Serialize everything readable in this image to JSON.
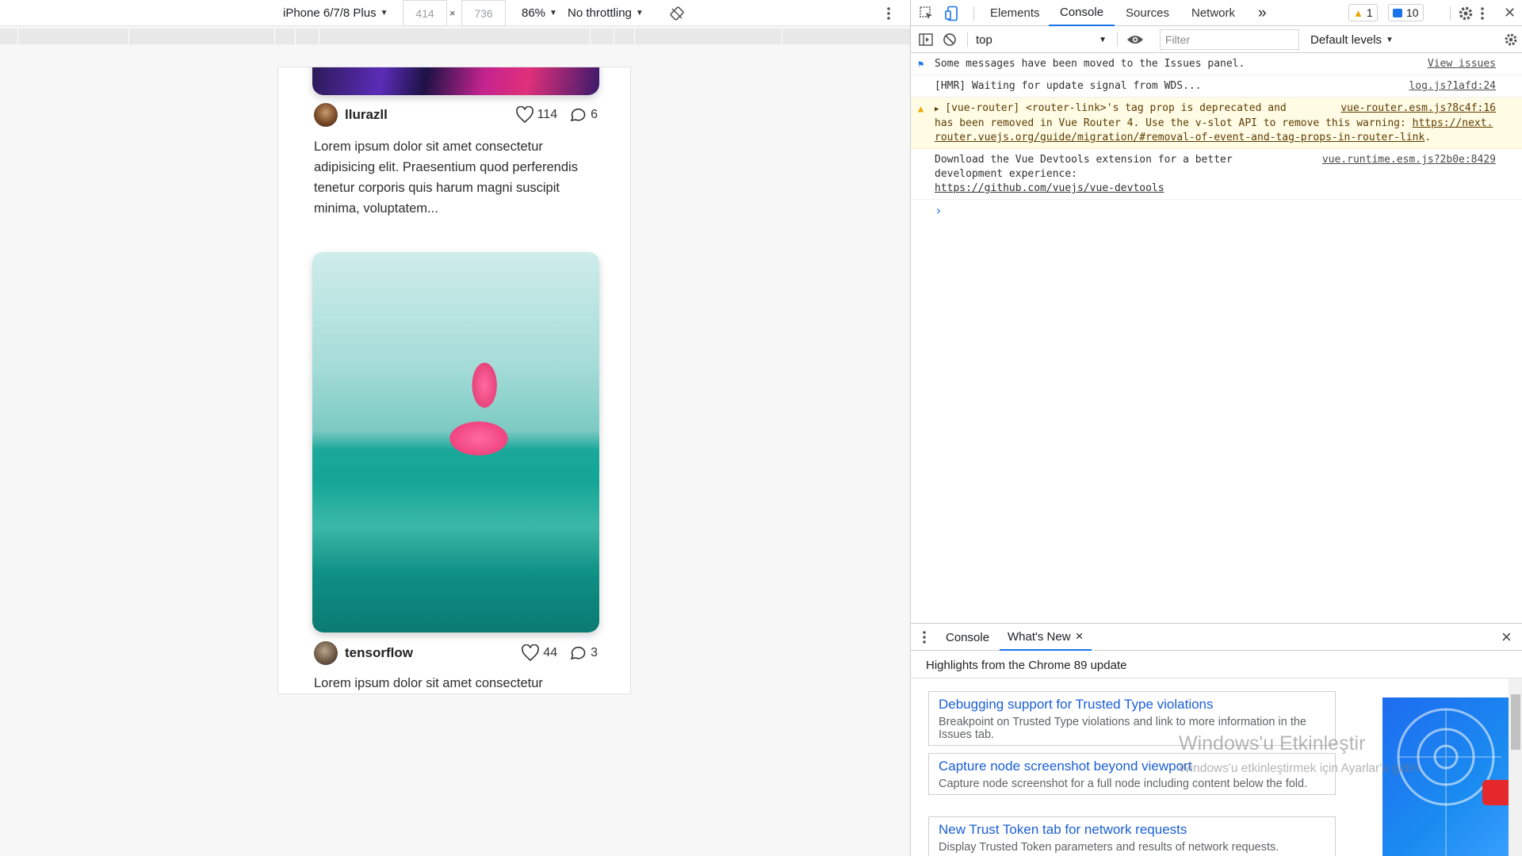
{
  "device_toolbar": {
    "device": "iPhone 6/7/8 Plus",
    "width": "414",
    "times": "×",
    "height": "736",
    "zoom": "86%",
    "throttling": "No throttling"
  },
  "posts": [
    {
      "username": "llurazll",
      "likes": "114",
      "comments": "6",
      "text": "Lorem ipsum dolor sit amet consectetur adipisicing elit. Praesentium quod perferendis tenetur corporis quis harum magni suscipit minima, voluptatem..."
    },
    {
      "username": "tensorflow",
      "likes": "44",
      "comments": "3",
      "text": "Lorem ipsum dolor sit amet consectetur"
    }
  ],
  "devtools": {
    "tabs": [
      "Elements",
      "Console",
      "Sources",
      "Network"
    ],
    "more_tabs": "»",
    "warning_count": "1",
    "message_count": "10",
    "context": "top",
    "filter_placeholder": "Filter",
    "levels": "Default levels"
  },
  "console_messages": {
    "moved": {
      "text": "Some messages have been moved to the Issues panel.",
      "link": "View issues"
    },
    "hmr": {
      "text": "[HMR] Waiting for update signal from WDS...",
      "source": "log.js?1afd:24"
    },
    "router": {
      "text_1": "[vue-router] <router-link>'s tag prop is deprecated and",
      "text_2": "has been removed in Vue Router 4. Use the v-slot API to remove this warning: ",
      "link": "https://next.router.vuejs.org/guide/migration/#removal-of-event-and-tag-props-in-router-link",
      "link_end": ".",
      "source": "vue-router.esm.js?8c4f:16"
    },
    "devtools_ext": {
      "text_1": "Download the Vue Devtools extension for a better",
      "text_2": "development experience:",
      "link": "https://github.com/vuejs/vue-devtools",
      "source": "vue.runtime.esm.js?2b0e:8429"
    },
    "prompt": "›"
  },
  "drawer": {
    "tabs": [
      "Console",
      "What's New"
    ],
    "close_tab": "×",
    "close_drawer": "×",
    "heading": "Highlights from the Chrome 89 update",
    "cards": [
      {
        "title": "Debugging support for Trusted Type violations",
        "desc": "Breakpoint on Trusted Type violations and link to more information in the Issues tab."
      },
      {
        "title": "Capture node screenshot beyond viewport",
        "desc": "Capture node screenshot for a full node including content below the fold."
      },
      {
        "title": "New Trust Token tab for network requests",
        "desc": "Display Trusted Token parameters and results of network requests."
      }
    ]
  },
  "watermark": {
    "title": "Windows'u Etkinleştir",
    "subtitle": "Windows'u etkinleştirmek için Ayarlar'a gidin."
  },
  "colors": {
    "accent": "#1a73e8",
    "warning_bg": "#fffbe5",
    "link": "#1a5fd6"
  },
  "icons": [
    "inspect-icon",
    "device-toggle-icon",
    "settings-gear-icon",
    "kebab-menu-icon",
    "clear-console-icon",
    "eye-icon",
    "rotate-icon",
    "heart-icon",
    "comment-icon",
    "warning-icon",
    "message-flag-icon"
  ]
}
